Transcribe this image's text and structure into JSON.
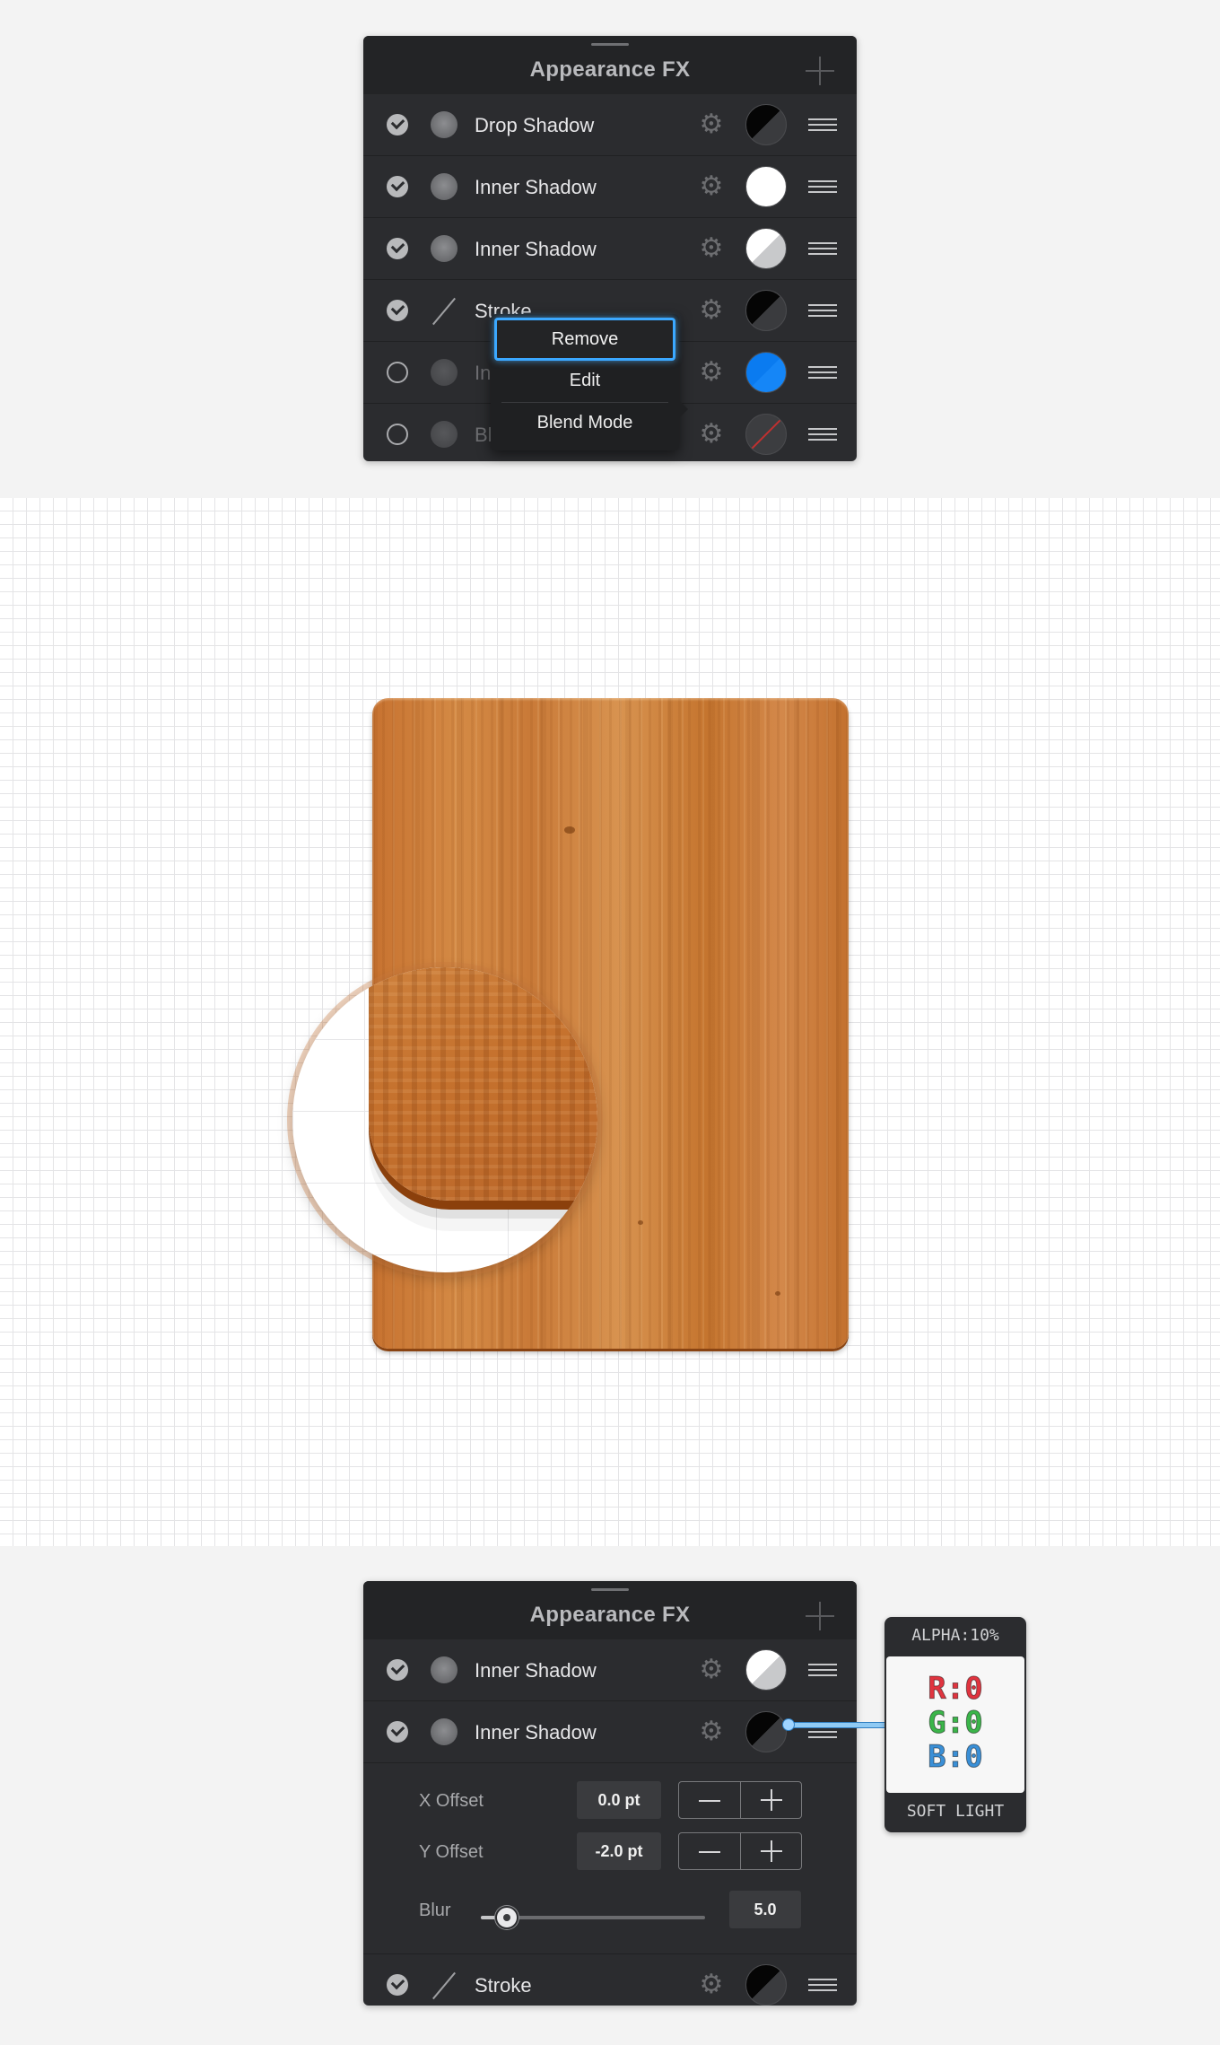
{
  "top_panel": {
    "title": "Appearance FX",
    "rows": [
      {
        "label": "Drop Shadow",
        "checked": true,
        "type": "shadow",
        "swatch": "black-dark"
      },
      {
        "label": "Inner Shadow",
        "checked": true,
        "type": "shadow",
        "swatch": "white"
      },
      {
        "label": "Inner Shadow",
        "checked": true,
        "type": "shadow",
        "swatch": "white-grey"
      },
      {
        "label": "Stroke",
        "checked": true,
        "type": "stroke",
        "swatch": "black-dark"
      },
      {
        "label": "In",
        "checked": false,
        "type": "shadow",
        "swatch": "blue"
      },
      {
        "label": "Bl",
        "checked": false,
        "type": "blur",
        "swatch": "none"
      }
    ]
  },
  "context_menu": {
    "items": [
      "Remove",
      "Edit",
      "Blend Mode"
    ]
  },
  "bottom_panel": {
    "title": "Appearance FX",
    "rows": [
      {
        "label": "Inner Shadow",
        "checked": true,
        "swatch": "white-grey"
      },
      {
        "label": "Inner Shadow",
        "checked": true,
        "swatch": "black-dark"
      }
    ],
    "settings": {
      "x_offset_label": "X Offset",
      "x_offset_value": "0.0 pt",
      "y_offset_label": "Y Offset",
      "y_offset_value": "-2.0 pt",
      "blur_label": "Blur",
      "blur_value": "5.0",
      "blur_level": 0.11
    },
    "stroke_row": {
      "label": "Stroke",
      "checked": true,
      "swatch": "black-dark"
    }
  },
  "callout": {
    "alpha": "ALPHA:10%",
    "r": "R:0",
    "g": "G:0",
    "b": "B:0",
    "blend": "SOFT LIGHT",
    "colors": {
      "r": "#e0343f",
      "g": "#3bb54a",
      "b": "#3a8fd6"
    }
  },
  "icons": {
    "check": "check-icon",
    "gear": "gear-icon",
    "handle": "drag-handle-icon",
    "add": "plus-icon"
  }
}
